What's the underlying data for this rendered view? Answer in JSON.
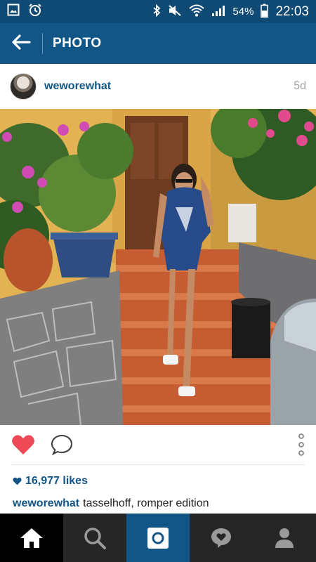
{
  "status_bar": {
    "battery": "54%",
    "time": "22:03",
    "icons": [
      "image-icon",
      "alarm-icon",
      "bluetooth-icon",
      "mute-icon",
      "wifi-icon",
      "signal-icon",
      "battery-icon"
    ]
  },
  "app_bar": {
    "title": "PHOTO",
    "back_icon": "arrow-left-icon"
  },
  "post": {
    "username": "weworewhat",
    "age": "5d",
    "likes": "16,977 likes",
    "caption_user": "weworewhat",
    "caption_text": "tasselhoff, romper edition",
    "liked": true,
    "colors": {
      "accent": "#125688",
      "like_red": "#ed4956",
      "statusbar": "#0e4a73"
    }
  },
  "bottom_nav": {
    "tabs": [
      "home-icon",
      "search-icon",
      "camera-icon",
      "activity-icon",
      "profile-icon"
    ],
    "active": "home-icon"
  }
}
